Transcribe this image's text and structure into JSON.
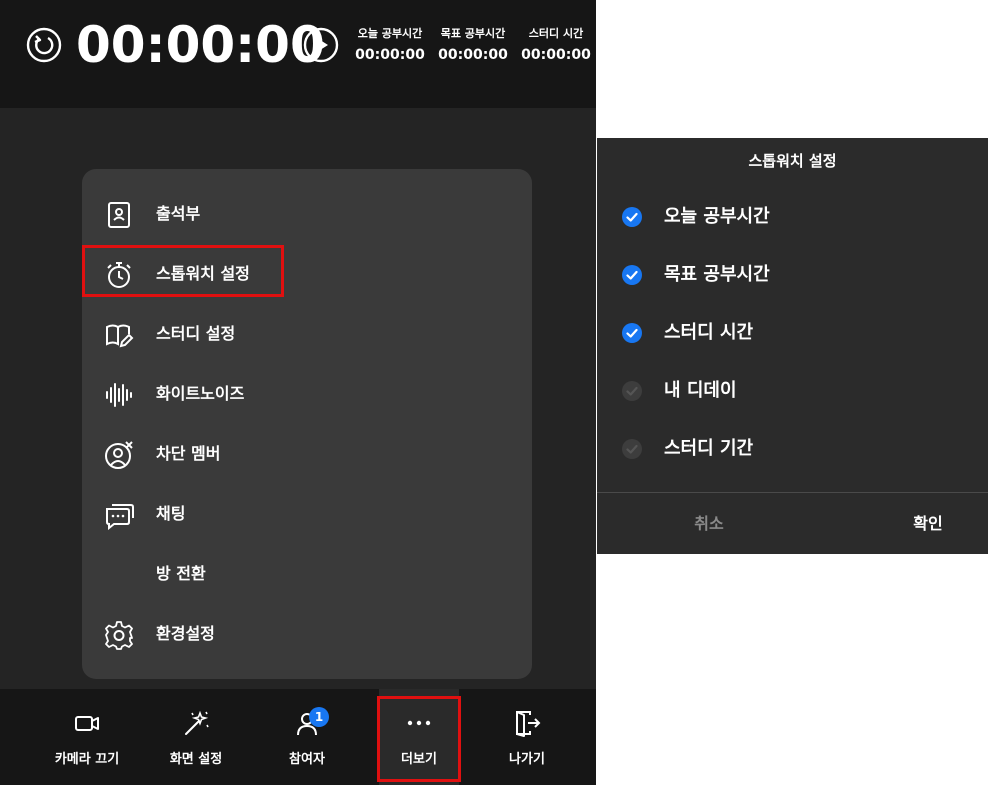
{
  "timer": {
    "main": "00:00:00",
    "stats": [
      {
        "label": "오늘 공부시간",
        "value": "00:00:00"
      },
      {
        "label": "목표 공부시간",
        "value": "00:00:00"
      },
      {
        "label": "스터디 시간",
        "value": "00:00:00"
      }
    ]
  },
  "menu": {
    "items": [
      {
        "label": "출석부",
        "icon": "attendance-book-icon"
      },
      {
        "label": "스톱워치 설정",
        "icon": "stopwatch-icon"
      },
      {
        "label": "스터디 설정",
        "icon": "book-edit-icon"
      },
      {
        "label": "화이트노이즈",
        "icon": "sound-wave-icon"
      },
      {
        "label": "차단 멤버",
        "icon": "blocked-user-icon"
      },
      {
        "label": "채팅",
        "icon": "chat-icon"
      },
      {
        "label": "방 전환",
        "icon": ""
      },
      {
        "label": "환경설정",
        "icon": "gear-icon"
      }
    ]
  },
  "bottom_nav": {
    "items": [
      {
        "label": "카메라 끄기",
        "icon": "camera-icon"
      },
      {
        "label": "화면 설정",
        "icon": "magic-wand-icon"
      },
      {
        "label": "참여자",
        "icon": "person-icon"
      },
      {
        "label": "더보기",
        "icon": "more-dots-icon"
      },
      {
        "label": "나가기",
        "icon": "exit-door-icon"
      }
    ],
    "participant_badge": "1"
  },
  "dialog": {
    "title": "스톱워치 설정",
    "options": [
      {
        "label": "오늘 공부시간",
        "checked": true
      },
      {
        "label": "목표 공부시간",
        "checked": true
      },
      {
        "label": "스터디 시간",
        "checked": true
      },
      {
        "label": "내 디데이",
        "checked": false
      },
      {
        "label": "스터디 기간",
        "checked": false
      }
    ],
    "cancel_label": "취소",
    "confirm_label": "확인"
  },
  "colors": {
    "accent": "#1877f2",
    "highlight": "#e01010",
    "panel": "#3a3a3a",
    "background": "#242424"
  }
}
